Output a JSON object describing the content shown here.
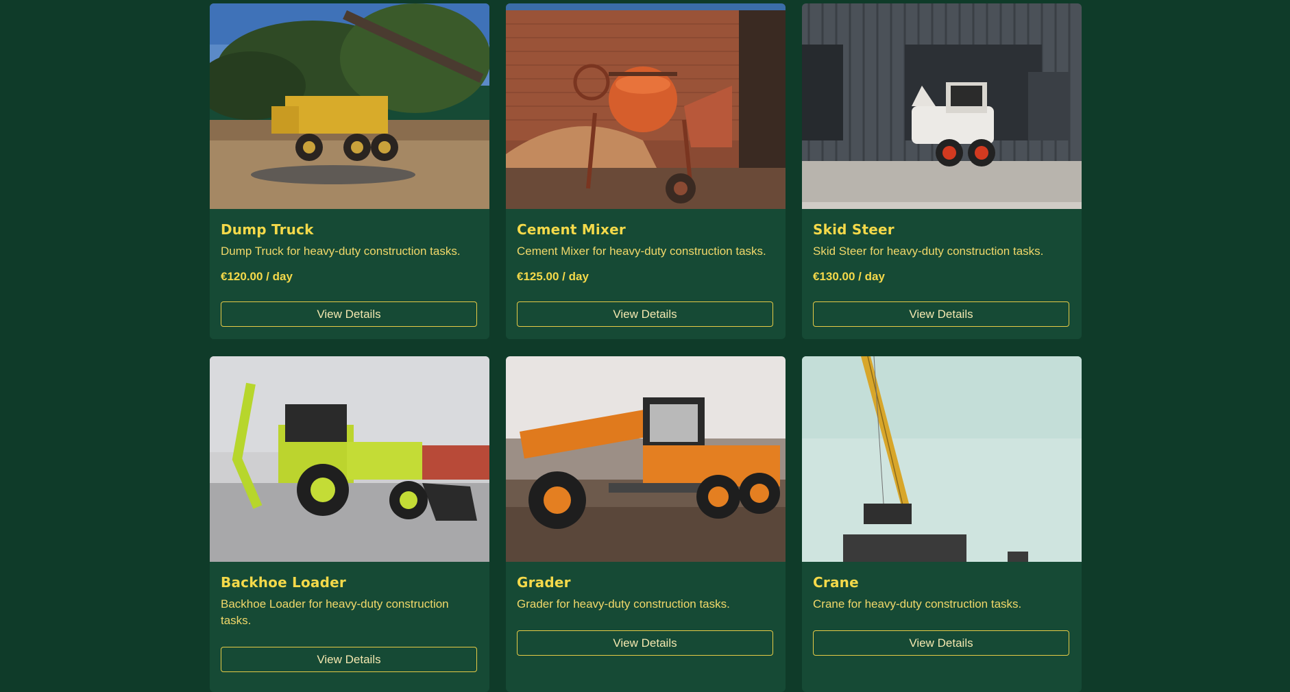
{
  "catalog": {
    "button_label": "View Details",
    "items": [
      {
        "name": "Dump Truck",
        "description": "Dump Truck for heavy-duty construction tasks.",
        "price": "€120.00 / day",
        "icon": "dump-truck-photo"
      },
      {
        "name": "Cement Mixer",
        "description": "Cement Mixer for heavy-duty construction tasks.",
        "price": "€125.00 / day",
        "icon": "cement-mixer-photo"
      },
      {
        "name": "Skid Steer",
        "description": "Skid Steer for heavy-duty construction tasks.",
        "price": "€130.00 / day",
        "icon": "skid-steer-photo"
      },
      {
        "name": "Backhoe Loader",
        "description": "Backhoe Loader for heavy-duty construction tasks.",
        "price": "",
        "icon": "backhoe-loader-photo"
      },
      {
        "name": "Grader",
        "description": "Grader for heavy-duty construction tasks.",
        "price": "",
        "icon": "grader-photo"
      },
      {
        "name": "Crane",
        "description": "Crane for heavy-duty construction tasks.",
        "price": "",
        "icon": "crane-photo"
      }
    ]
  },
  "colors": {
    "page_background": "#0f3b29",
    "card_background": "#164a35",
    "accent": "#f4d94a"
  }
}
